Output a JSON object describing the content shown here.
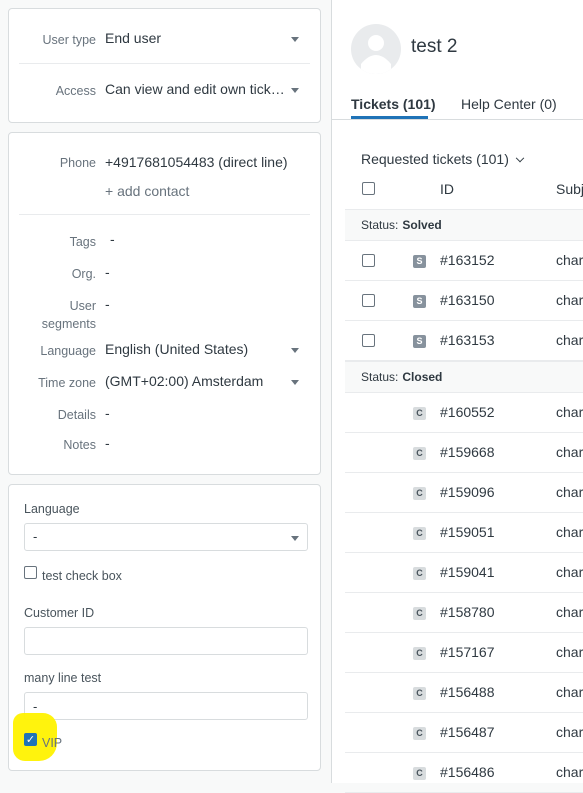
{
  "user_panel": {
    "user_type_label": "User type",
    "user_type_value": "End user",
    "access_label": "Access",
    "access_value": "Can view and edit own tick…"
  },
  "contact_panel": {
    "phone_label": "Phone",
    "phone_value": "+4917681054483 (direct line)",
    "add_contact": "+ add contact",
    "tags_label": "Tags",
    "tags_value": "-",
    "org_label": "Org.",
    "org_value": "-",
    "segments_label_1": "User",
    "segments_label_2": "segments",
    "segments_value": "-",
    "language_label": "Language",
    "language_value": "English (United States)",
    "timezone_label": "Time zone",
    "timezone_value": "(GMT+02:00) Amsterdam",
    "details_label": "Details",
    "details_value": "-",
    "notes_label": "Notes",
    "notes_value": "-"
  },
  "fields_panel": {
    "language_label": "Language",
    "language_value": "-",
    "test_checkbox_label": "test check box",
    "customer_id_label": "Customer ID",
    "customer_id_value": "",
    "many_line_label": "many line test",
    "many_line_value": "-",
    "vip_label": "VIP",
    "vip_checked": true
  },
  "profile": {
    "name": "test 2"
  },
  "tabs": [
    {
      "label": "Tickets (101)",
      "active": true
    },
    {
      "label": "Help Center (0)",
      "active": false
    }
  ],
  "tickets": {
    "header": "Requested tickets (101)",
    "col_id": "ID",
    "col_subject": "Subj",
    "groups": [
      {
        "status_prefix": "Status:",
        "status": "Solved",
        "badge": "S",
        "rows": [
          {
            "id": "#163152",
            "subject": "char"
          },
          {
            "id": "#163150",
            "subject": "char"
          },
          {
            "id": "#163153",
            "subject": "char"
          }
        ]
      },
      {
        "status_prefix": "Status:",
        "status": "Closed",
        "badge": "C",
        "rows": [
          {
            "id": "#160552",
            "subject": "char"
          },
          {
            "id": "#159668",
            "subject": "char"
          },
          {
            "id": "#159096",
            "subject": "char"
          },
          {
            "id": "#159051",
            "subject": "char"
          },
          {
            "id": "#159041",
            "subject": "char"
          },
          {
            "id": "#158780",
            "subject": "char"
          },
          {
            "id": "#157167",
            "subject": "char"
          },
          {
            "id": "#156488",
            "subject": "char"
          },
          {
            "id": "#156487",
            "subject": "char"
          },
          {
            "id": "#156486",
            "subject": "char"
          }
        ]
      }
    ]
  },
  "colors": {
    "accent": "#1f73b7",
    "solved_badge": "#87929d",
    "closed_badge": "#d8dcde",
    "highlight": "#fff200"
  }
}
